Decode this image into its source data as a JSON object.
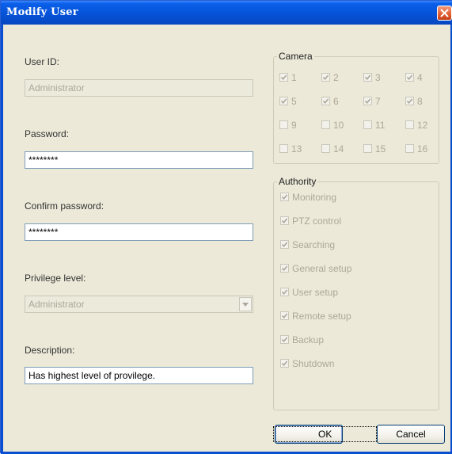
{
  "window": {
    "title": "Modify User"
  },
  "form": {
    "user_id": {
      "label": "User ID:",
      "value": "Administrator"
    },
    "password": {
      "label": "Password:",
      "value": "********"
    },
    "confirm_password": {
      "label": "Confirm password:",
      "value": "********"
    },
    "privilege_level": {
      "label": "Privilege level:",
      "value": "Administrator"
    },
    "description": {
      "label": "Description:",
      "value": "Has highest level of provilege."
    }
  },
  "camera": {
    "title": "Camera",
    "items": [
      {
        "label": "1",
        "checked": true
      },
      {
        "label": "2",
        "checked": true
      },
      {
        "label": "3",
        "checked": true
      },
      {
        "label": "4",
        "checked": true
      },
      {
        "label": "5",
        "checked": true
      },
      {
        "label": "6",
        "checked": true
      },
      {
        "label": "7",
        "checked": true
      },
      {
        "label": "8",
        "checked": true
      },
      {
        "label": "9",
        "checked": false
      },
      {
        "label": "10",
        "checked": false
      },
      {
        "label": "11",
        "checked": false
      },
      {
        "label": "12",
        "checked": false
      },
      {
        "label": "13",
        "checked": false
      },
      {
        "label": "14",
        "checked": false
      },
      {
        "label": "15",
        "checked": false
      },
      {
        "label": "16",
        "checked": false
      }
    ]
  },
  "authority": {
    "title": "Authority",
    "items": [
      {
        "label": "Monitoring",
        "checked": true
      },
      {
        "label": "PTZ control",
        "checked": true
      },
      {
        "label": "Searching",
        "checked": true
      },
      {
        "label": "General setup",
        "checked": true
      },
      {
        "label": "User setup",
        "checked": true
      },
      {
        "label": "Remote setup",
        "checked": true
      },
      {
        "label": "Backup",
        "checked": true
      },
      {
        "label": "Shutdown",
        "checked": true
      }
    ]
  },
  "buttons": {
    "ok": "OK",
    "cancel": "Cancel"
  }
}
